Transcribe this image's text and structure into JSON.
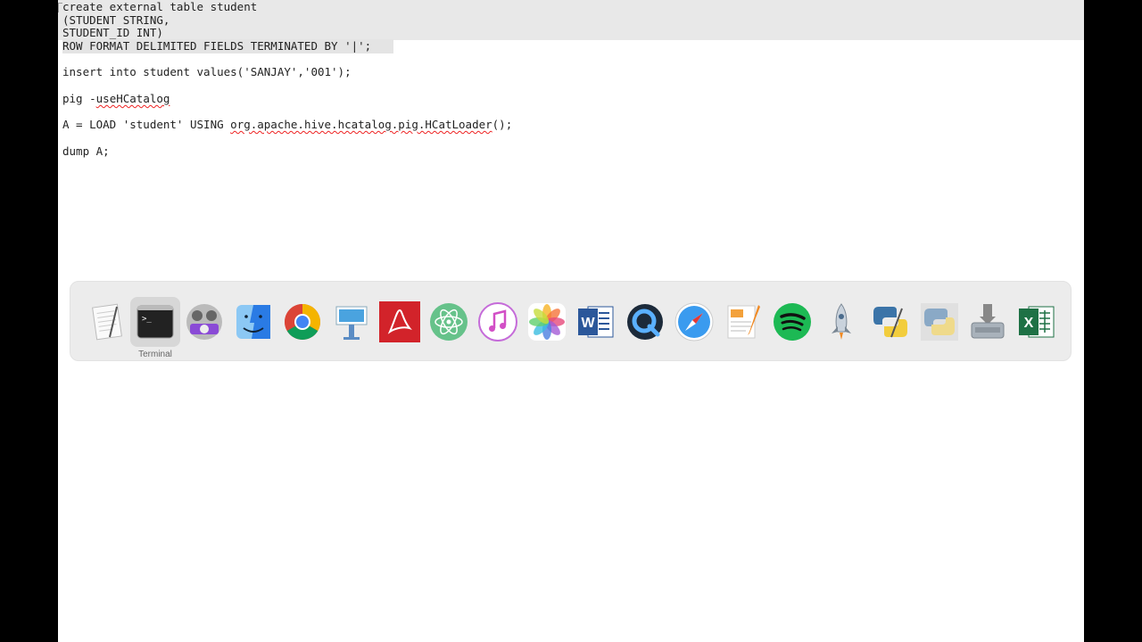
{
  "editor": {
    "lines": [
      "create external table student",
      "(STUDENT STRING,",
      "STUDENT_ID INT)",
      "ROW FORMAT DELIMITED FIELDS TERMINATED BY '|';",
      "insert into student values('SANJAY','001');",
      "pig -",
      "useHCatalog",
      "A = LOAD 'student' USING ",
      "org.apache.hive.hcatalog.pig.HCatLoader",
      "();",
      "dump A;"
    ]
  },
  "dock": {
    "hover_label": "Terminal",
    "apps": [
      "textedit-icon",
      "terminal-icon",
      "photo-booth-icon",
      "finder-icon",
      "chrome-icon",
      "keynote-icon",
      "acrobat-icon",
      "atom-icon",
      "itunes-icon",
      "photos-icon",
      "word-icon",
      "quicktime-icon",
      "safari-icon",
      "pages-icon",
      "spotify-icon",
      "rocket-icon",
      "python-launcher-icon",
      "python-icon",
      "installer-icon",
      "excel-icon"
    ]
  },
  "colors": {
    "selection": "#e8e8e8",
    "spellcheck": "#e22222",
    "spotify": "#1db954",
    "excel": "#1e7145",
    "word": "#2b579a"
  }
}
